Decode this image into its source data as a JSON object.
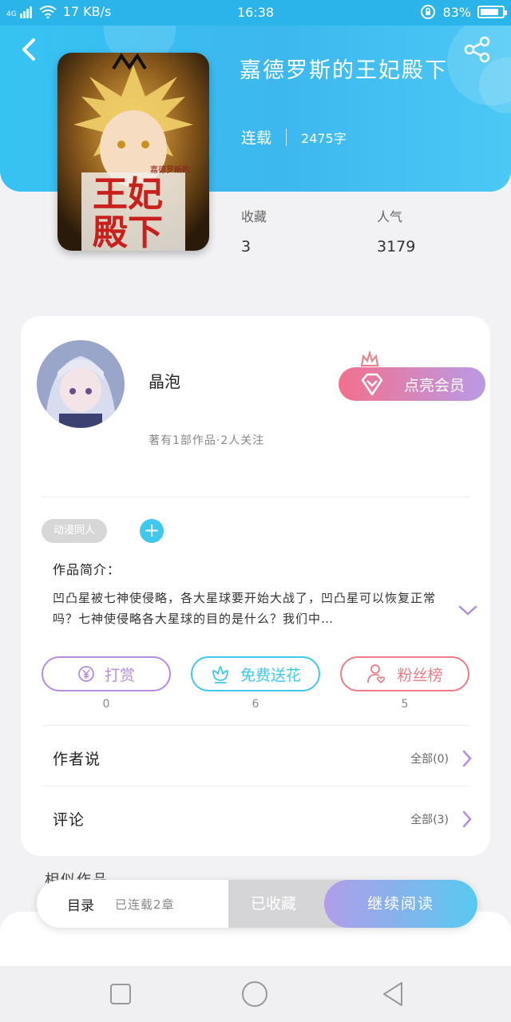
{
  "status_bar": {
    "network": "4G",
    "speed": "17 KB/s",
    "time": "16:38",
    "battery": "83%",
    "battery_level": 0.83
  },
  "book": {
    "title": "嘉德罗斯的王妃殿下",
    "status": "连载",
    "word_count": "2475字",
    "cover_text_top": "嘉德罗斯的",
    "cover_text_main": "王妃殿下",
    "stats": [
      {
        "label": "收藏",
        "value": "3"
      },
      {
        "label": "人气",
        "value": "3179"
      }
    ]
  },
  "author": {
    "name": "晶泡",
    "meta": "著有1部作品·2人关注",
    "vip_label": "点亮会员"
  },
  "tags": [
    "动漫同人"
  ],
  "intro": {
    "title": "作品简介：",
    "text": "凹凸星被七神使侵略，各大星球要开始大战了，凹凸星可以恢复正常吗？七神使侵略各大星球的目的是什么？我们中…"
  },
  "actions": [
    {
      "label": "打赏",
      "count": "0",
      "color": "#b58de0"
    },
    {
      "label": "免费送花",
      "count": "6",
      "color": "#3ec8ee"
    },
    {
      "label": "粉丝榜",
      "count": "5",
      "color": "#f07a86"
    }
  ],
  "sections": [
    {
      "label": "作者说",
      "all": "全部(0)"
    },
    {
      "label": "评论",
      "all": "全部(3)"
    }
  ],
  "related_peek": "相似作品",
  "bottom_bar": {
    "toc": "目录",
    "toc_sub": "已连载2章",
    "fav": "已收藏",
    "read": "继续阅读"
  },
  "colors": {
    "header": "#3db8ef",
    "accent_purple": "#b58de0",
    "accent_cyan": "#3ec8ee",
    "accent_pink": "#f07a86"
  }
}
